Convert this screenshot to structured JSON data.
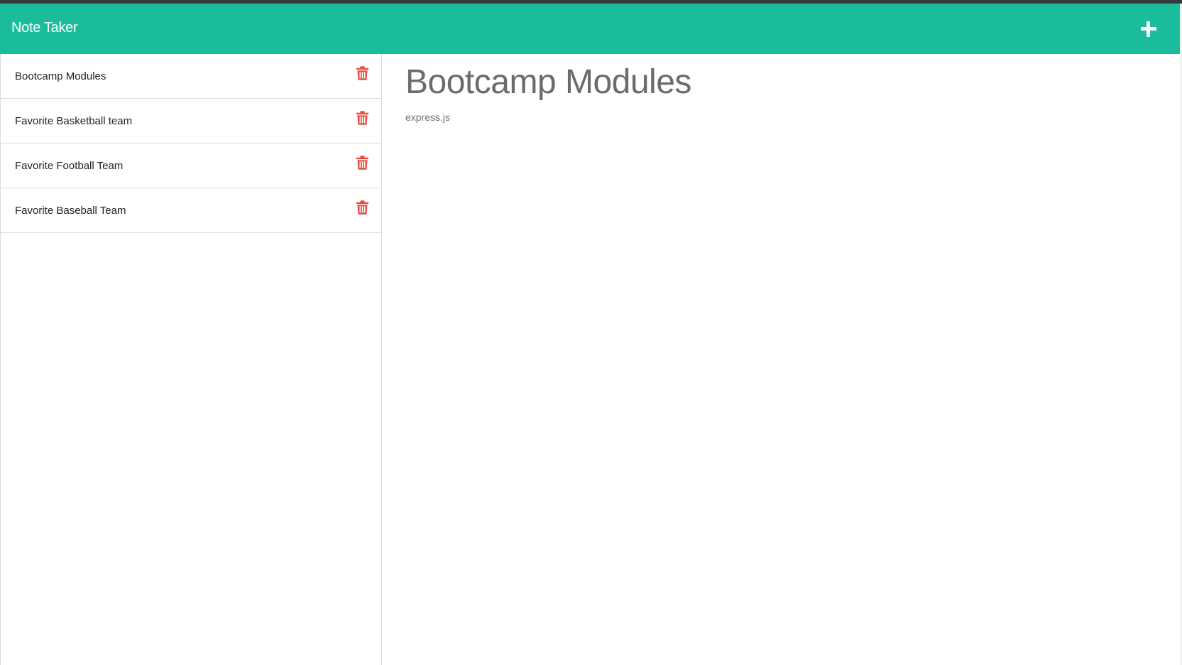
{
  "app": {
    "title": "Note Taker",
    "add_icon": "plus-icon"
  },
  "colors": {
    "navbar": "#1abc9c",
    "delete_icon": "#e74c3c",
    "top_strip": "#343a40"
  },
  "notes": [
    {
      "title": "Bootcamp Modules",
      "icon": "trash-icon"
    },
    {
      "title": "Favorite Basketball team",
      "icon": "trash-icon"
    },
    {
      "title": "Favorite Football Team",
      "icon": "trash-icon"
    },
    {
      "title": "Favorite Baseball Team",
      "icon": "trash-icon"
    }
  ],
  "active_note": {
    "title": "Bootcamp Modules",
    "text": "express.js"
  }
}
